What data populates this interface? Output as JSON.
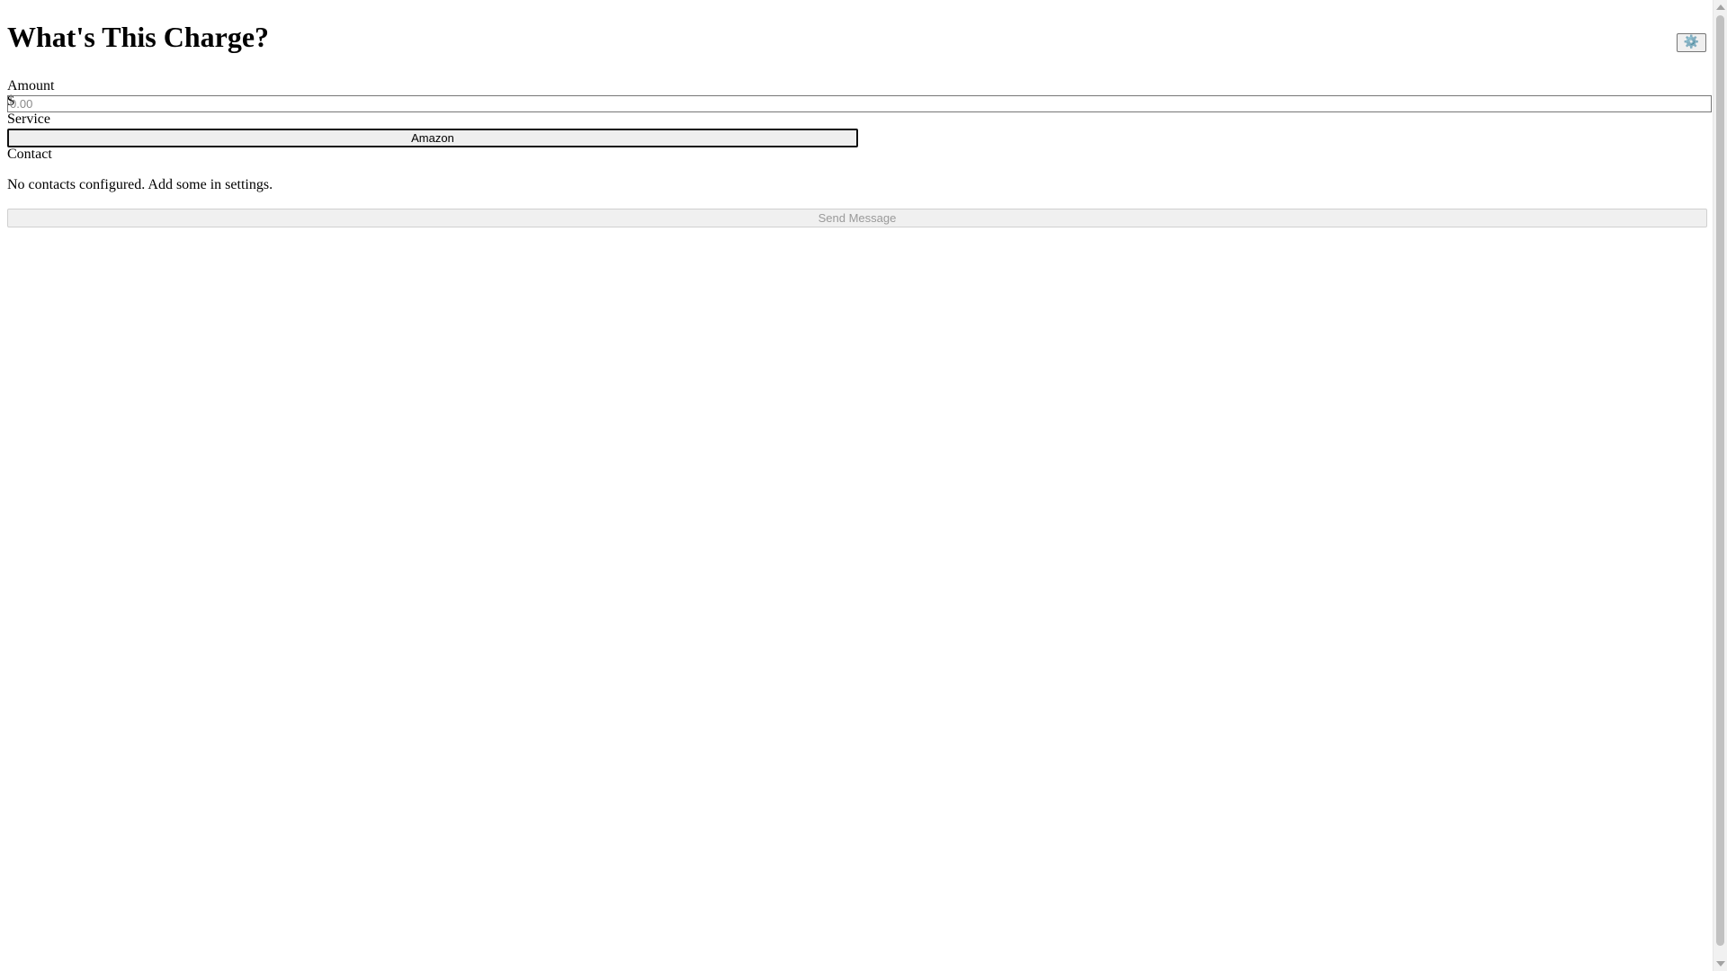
{
  "header": {
    "title": "What's This Charge?",
    "settings_icon": "gear-icon",
    "settings_glyph": "⚙️"
  },
  "amount": {
    "label": "Amount",
    "currency_symbol": "$",
    "placeholder": "0.00",
    "value": ""
  },
  "service": {
    "label": "Service",
    "selected": "Amazon"
  },
  "contact": {
    "label": "Contact",
    "empty_message": "No contacts configured. Add some in settings."
  },
  "actions": {
    "send_label": "Send Message",
    "send_disabled": true
  },
  "colors": {
    "settings_icon": "#4a7fb5",
    "disabled_text": "#9a9a9a"
  }
}
